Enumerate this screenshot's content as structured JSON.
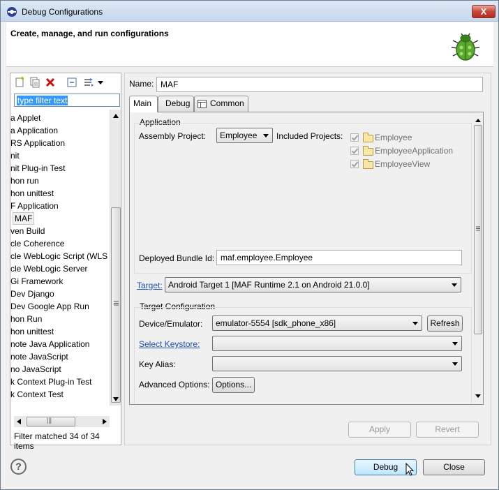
{
  "window": {
    "title": "Debug Configurations",
    "close_glyph": "X"
  },
  "banner": {
    "title": "Create, manage, and run configurations",
    "icon": "debug-bug-icon"
  },
  "left": {
    "toolbar_icons": [
      "new-configuration-icon",
      "duplicate-icon",
      "delete-icon",
      "collapse-all-icon",
      "filter-icon",
      "dropdown-arrow-icon"
    ],
    "filter_placeholder": "type filter text",
    "tree_items": [
      "a Applet",
      "a Application",
      "RS Application",
      "nit",
      "nit Plug-in Test",
      "hon run",
      "hon unittest",
      "F Application",
      "MAF",
      "ven Build",
      "cle Coherence",
      "cle WebLogic Script (WLS",
      "cle WebLogic Server",
      "Gi Framework",
      "Dev Django",
      "Dev Google App Run",
      "hon Run",
      "hon unittest",
      "note Java Application",
      "note JavaScript",
      "no JavaScript",
      "k Context Plug-in Test",
      "k Context Test",
      "."
    ],
    "selected_item": "MAF",
    "status": "Filter matched 34 of 34 items",
    "hscroll_glyph": "|||"
  },
  "right": {
    "name_label": "Name:",
    "name_value": "MAF",
    "tabs": [
      "Main",
      "Debug",
      "Common"
    ],
    "application": {
      "group_title": "Application",
      "assembly_label": "Assembly Project:",
      "assembly_value": "Employee",
      "included_label": "Included Projects:",
      "included": [
        "Employee",
        "EmployeeApplication",
        "EmployeeView"
      ],
      "bundle_label": "Deployed Bundle Id:",
      "bundle_value": "maf.employee.Employee"
    },
    "target": {
      "label": "Target:",
      "value": "Android Target 1 [MAF Runtime 2.1 on Android 21.0.0]"
    },
    "target_config": {
      "group_title": "Target Configuration",
      "device_label": "Device/Emulator:",
      "device_value": "emulator-5554 [sdk_phone_x86]",
      "refresh_label": "Refresh",
      "keystore_label": "Select Keystore:",
      "key_alias_label": "Key Alias:",
      "advanced_label": "Advanced Options:",
      "options_button": "Options..."
    },
    "apply_label": "Apply",
    "revert_label": "Revert"
  },
  "footer": {
    "help_glyph": "?",
    "debug_label": "Debug",
    "close_label": "Close"
  }
}
